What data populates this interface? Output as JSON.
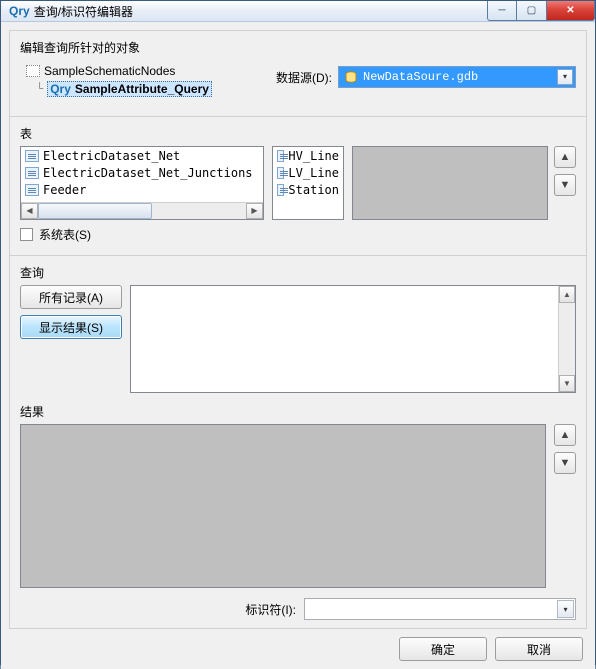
{
  "window": {
    "title_prefix": "Qry",
    "title": "查询/标识符编辑器"
  },
  "sections": {
    "target_label": "编辑查询所针对的对象",
    "tree": {
      "root": "SampleSchematicNodes",
      "child_prefix": "Qry",
      "child": "SampleAttribute_Query"
    },
    "datasource_label": "数据源(D):",
    "datasource_value": "NewDataSoure.gdb",
    "table_label": "表",
    "tables_left": [
      "ElectricDataset_Net",
      "ElectricDataset_Net_Junctions",
      "Feeder"
    ],
    "tables_mid": [
      "HV_Line",
      "LV_Line",
      "Station"
    ],
    "system_tables_label": "系统表(S)",
    "query_label": "查询",
    "all_records_btn": "所有记录(A)",
    "show_result_btn": "显示结果(S)",
    "result_label": "结果",
    "identifier_label": "标识符(I):"
  },
  "footer": {
    "ok": "确定",
    "cancel": "取消"
  },
  "icons": {
    "up": "▲",
    "down": "▼",
    "left": "◀",
    "right": "▶",
    "dropdown": "▾",
    "close": "✕",
    "min": "─",
    "max": "▢"
  }
}
